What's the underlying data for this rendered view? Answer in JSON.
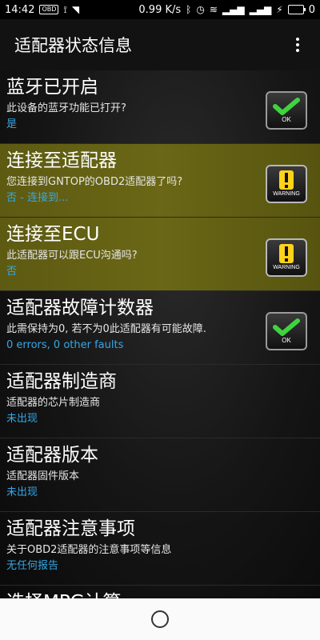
{
  "status_bar": {
    "time": "14:42",
    "net_speed": "0.99 K/s",
    "battery_level": "0",
    "left_icons": [
      "obd-icon",
      "usb-icon",
      "signal-icon"
    ],
    "right_icons": [
      "bluetooth-icon",
      "alarm-icon",
      "wifi-icon",
      "cellular-icon",
      "cellular-icon-2",
      "charging-icon",
      "battery-icon"
    ]
  },
  "app_bar": {
    "title": "适配器状态信息"
  },
  "items": [
    {
      "title": "蓝牙已开启",
      "desc": "此设备的蓝牙功能已打开?",
      "status": "是",
      "badge": "OK",
      "highlight": false
    },
    {
      "title": "连接至适配器",
      "desc": "您连接到GNTOP的OBD2适配器了吗?",
      "status": "否 - 连接到...",
      "badge": "WARNING",
      "highlight": true
    },
    {
      "title": "连接至ECU",
      "desc": "此适配器可以跟ECU沟通吗?",
      "status": "否",
      "badge": "WARNING",
      "highlight": true
    },
    {
      "title": "适配器故障计数器",
      "desc": "此需保持为0, 若不为0此适配器有可能故障.",
      "status": "0 errors, 0 other faults",
      "badge": "OK",
      "highlight": false
    },
    {
      "title": "适配器制造商",
      "desc": "适配器的芯片制造商",
      "status": "未出现",
      "badge": "",
      "highlight": false
    },
    {
      "title": "适配器版本",
      "desc": "适配器固件版本",
      "status": "未出现",
      "badge": "",
      "highlight": false
    },
    {
      "title": "适配器注意事项",
      "desc": "关于OBD2适配器的注意事项等信息",
      "status": "无任何报告",
      "badge": "",
      "highlight": false
    },
    {
      "title": "选择MPG计算",
      "desc": "",
      "status": "",
      "badge": "",
      "highlight": false
    }
  ],
  "colors": {
    "status_link": "#36a8e6",
    "warning_bg": "#66631a",
    "ok_check": "#3fd43f",
    "warning_mark": "#ffd21a"
  }
}
